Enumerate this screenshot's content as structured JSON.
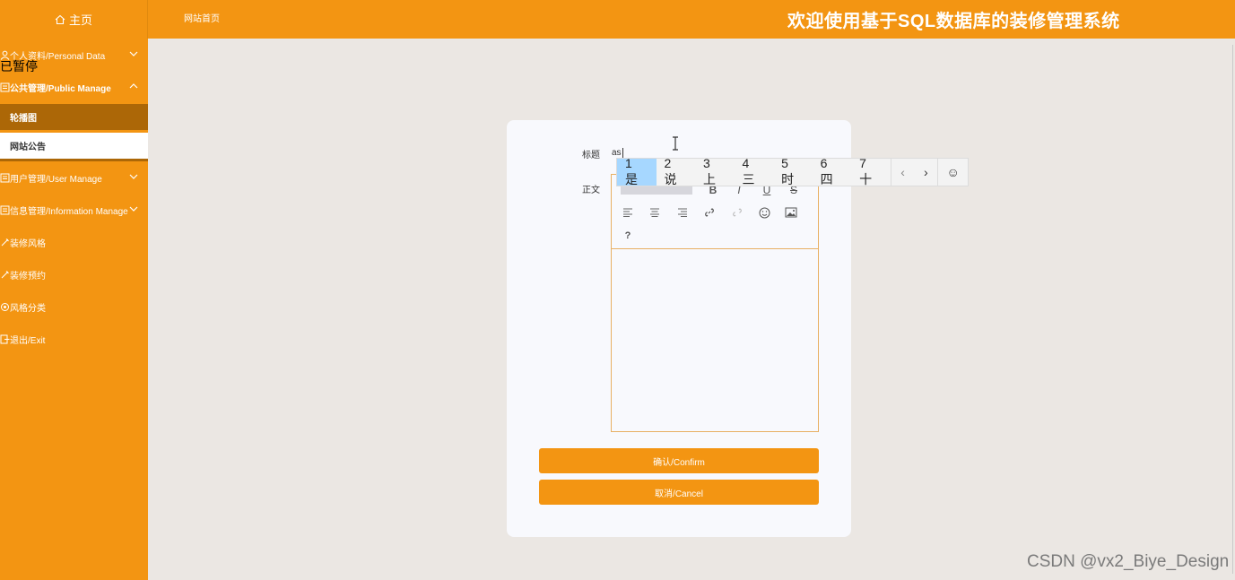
{
  "header": {
    "home_label": "主页",
    "breadcrumb": "网站首页",
    "welcome": "欢迎使用基于SQL数据库的装修管理系统"
  },
  "sidebar": {
    "items": [
      {
        "label": "个人资料/Personal Data"
      },
      {
        "label": "公共管理/Public Manage"
      },
      {
        "label": "用户管理/User Manage"
      },
      {
        "label": "信息管理/Information Manage"
      },
      {
        "label": "装修风格"
      },
      {
        "label": "装修预约"
      },
      {
        "label": "风格分类"
      },
      {
        "label": "退出/Exit"
      }
    ],
    "sub_items": [
      {
        "label": "轮播图"
      },
      {
        "label": "网站公告"
      }
    ],
    "paused_text": "已暂停"
  },
  "form": {
    "title_label": "标题",
    "title_value": "as",
    "body_label": "正文",
    "confirm_label": "确认/Confirm",
    "cancel_label": "取消/Cancel"
  },
  "editor_toolbar": {
    "bold": "B",
    "italic": "I",
    "underline": "U",
    "strike": "S",
    "help": "?"
  },
  "ime": {
    "candidates": [
      "1 是",
      "2 说",
      "3 上",
      "4 三",
      "5 时",
      "6 四",
      "7 十"
    ],
    "prev": "‹",
    "next": "›",
    "emoji": "☺"
  },
  "watermark": "CSDN @vx2_Biye_Design",
  "colors": {
    "accent": "#f39512",
    "active_sub": "#ac6707",
    "background": "#ebe7e3"
  }
}
